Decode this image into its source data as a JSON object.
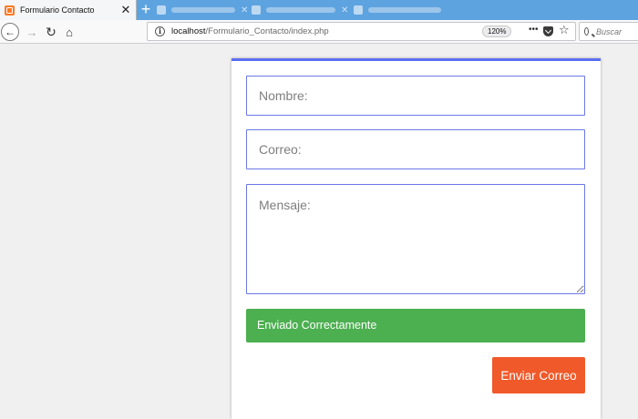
{
  "browser": {
    "active_tab": {
      "title": "Formulario Contacto",
      "close_glyph": "✕",
      "favicon": "xampp-icon"
    },
    "new_tab_glyph": "+",
    "nav": {
      "back_glyph": "←",
      "forward_glyph": "→",
      "reload_glyph": "↻",
      "home_glyph": "⌂",
      "info_glyph": "i",
      "url_host": "localhost",
      "url_path": "/Formulario_Contacto/index.php",
      "zoom": "120%",
      "more_glyph": "•••",
      "star_glyph": "☆",
      "search_placeholder": "Buscar"
    }
  },
  "form": {
    "name_placeholder": "Nombre:",
    "email_placeholder": "Correo:",
    "message_placeholder": "Mensaje:",
    "success_message": "Enviado Correctamente",
    "submit_label": "Enviar Correo"
  },
  "colors": {
    "accent": "#5b6ef0",
    "success": "#4caf50",
    "button": "#f05a2a",
    "tabstrip": "#5da3e0"
  }
}
